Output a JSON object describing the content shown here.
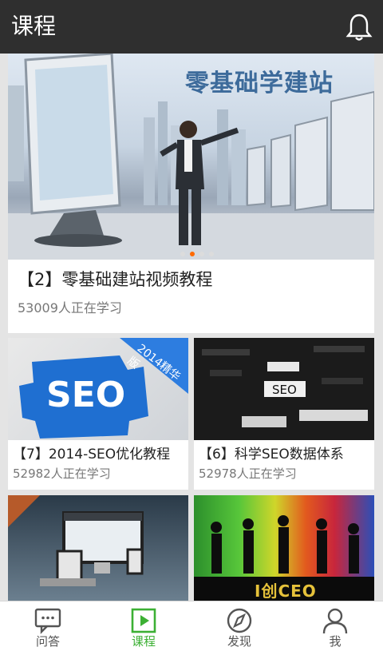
{
  "header": {
    "title": "课程",
    "notification_icon": "bell-icon"
  },
  "featured": {
    "banner_text": "零基础学建站",
    "title": "【2】零基础建站视频教程",
    "learners": "53009人正在学习",
    "carousel": {
      "total": 4,
      "active": 1
    }
  },
  "courses": [
    {
      "title": "【7】2014-SEO优化教程",
      "learners": "52982人正在学习",
      "thumb_text": "SEO",
      "thumb_ribbon": "2014精华版"
    },
    {
      "title": "【6】科学SEO数据体系",
      "learners": "52978人正在学习",
      "thumb_text": "SEO"
    },
    {
      "title": "",
      "learners": ""
    },
    {
      "title": "",
      "learners": "",
      "thumb_text": "I创CEO"
    }
  ],
  "nav": {
    "items": [
      {
        "label": "问答",
        "icon": "chat-icon"
      },
      {
        "label": "课程",
        "icon": "play-icon"
      },
      {
        "label": "发现",
        "icon": "compass-icon"
      },
      {
        "label": "我",
        "icon": "user-icon"
      }
    ],
    "active_index": 1,
    "accent_color": "#3cb034"
  },
  "colors": {
    "topbar": "#2f2f2f",
    "background": "#e4e4e4"
  }
}
